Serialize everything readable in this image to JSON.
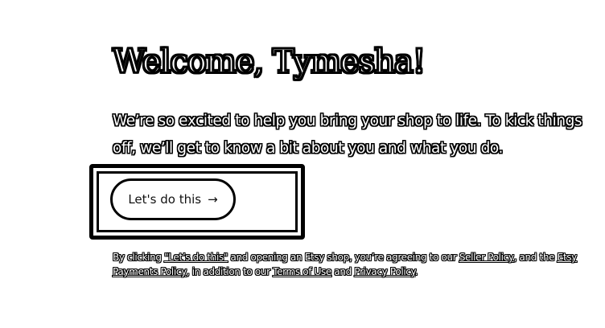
{
  "welcome": {
    "title": "Welcome, Tymesha!",
    "intro": "We’re so excited to help you bring your shop to life. To kick things off, we’ll get to know a bit about you and what you do."
  },
  "cta": {
    "label": "Let's do this",
    "icon": "arrow-right-icon",
    "glyph": "→"
  },
  "legal": {
    "prefix": "By clicking ",
    "quoted_cta": "\"Let’s do this\"",
    "middle": " and opening an Etsy shop, you’re agreeing to our ",
    "seller_policy": "Seller Policy",
    "and_the": ", and the ",
    "payments_policy": "Etsy Payments Policy",
    "addition": ", in addition to our ",
    "terms": "Terms of Use",
    "and": " and ",
    "privacy": "Privacy Policy",
    "end": "."
  }
}
